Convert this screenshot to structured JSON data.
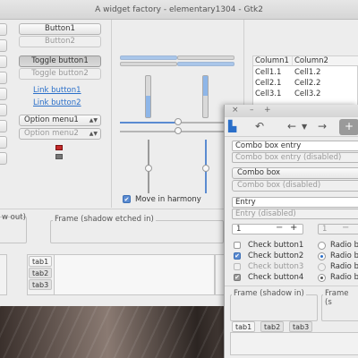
{
  "window": {
    "title": "A widget factory - elementary1304 - Gtk2"
  },
  "buttons": {
    "button1": "Button1",
    "button2": "Button2",
    "toggle1": "Toggle button1",
    "toggle2": "Toggle button2",
    "link1": "Link button1",
    "link2": "Link button2",
    "option1": "Option menu1",
    "option2": "Option menu2"
  },
  "sliders": {
    "harmony_label": "Move in harmony",
    "harmony_checked": true
  },
  "table": {
    "headers": [
      "Column1",
      "Column2"
    ],
    "rows": [
      [
        "Cell1.1",
        "Cell1.2"
      ],
      [
        "Cell2.1",
        "Cell2.2"
      ],
      [
        "Cell3.1",
        "Cell3.2"
      ]
    ]
  },
  "frames": {
    "shadow_out": "w out)",
    "shadow_etched_in": "Frame (shadow etched in)"
  },
  "tabs": [
    "tab1",
    "tab2",
    "tab3"
  ],
  "win2": {
    "controls": [
      "×",
      "–",
      "+"
    ],
    "combo_entry": "Combo box entry",
    "combo_entry_disabled": "Combo box entry (disabled)",
    "combo_box": "Combo box",
    "combo_box_disabled": "Combo box (disabled)",
    "entry": "Entry",
    "entry_disabled": "Entry (disabled)",
    "spin_value": "1",
    "spin_value_disabled": "1",
    "checks": [
      {
        "label": "Check button1",
        "checked": false,
        "disabled": false
      },
      {
        "label": "Check button2",
        "checked": true,
        "disabled": false
      },
      {
        "label": "Check button3",
        "checked": false,
        "disabled": true
      },
      {
        "label": "Check button4",
        "checked": true,
        "disabled": false
      }
    ],
    "radios": [
      "Radio b",
      "Radio b",
      "Radio b",
      "Radio b"
    ],
    "frame_shadow_in": "Frame (shadow in)",
    "frame_s": "Frame (s",
    "tabs": [
      "tab1",
      "tab2",
      "tab3"
    ]
  }
}
